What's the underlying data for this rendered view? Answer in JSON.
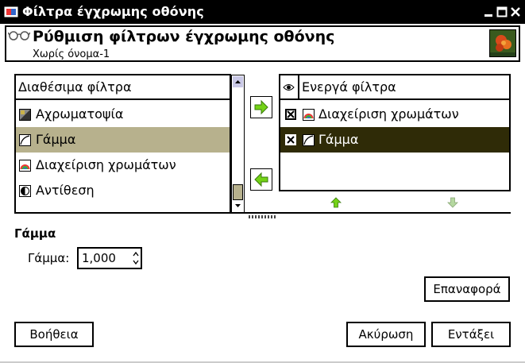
{
  "window": {
    "title": "Φίλτρα έγχρωμης οθόνης"
  },
  "header": {
    "title": "Ρύθμιση φίλτρων έγχρωμης οθόνης",
    "subtitle": "Χωρίς όνομα-1"
  },
  "available": {
    "heading": "Διαθέσιμα φίλτρα",
    "items": [
      {
        "label": "Αχρωματοψία",
        "icon": "color-deficient-icon"
      },
      {
        "label": "Γάμμα",
        "icon": "gamma-icon"
      },
      {
        "label": "Διαχείριση χρωμάτων",
        "icon": "color-management-icon"
      },
      {
        "label": "Αντίθεση",
        "icon": "contrast-icon"
      }
    ]
  },
  "active": {
    "heading": "Ενεργά φίλτρα",
    "items": [
      {
        "label": "Διαχείριση χρωμάτων",
        "icon": "color-management-icon",
        "checked": true
      },
      {
        "label": "Γάμμα",
        "icon": "gamma-icon",
        "checked": true
      }
    ]
  },
  "settings": {
    "section_title": "Γάμμα",
    "gamma_label": "Γάμμα:",
    "gamma_value": "1,000"
  },
  "buttons": {
    "reset": "Επαναφορά",
    "help": "Βοήθεια",
    "cancel": "Ακύρωση",
    "ok": "Εντάξει"
  },
  "colors": {
    "titlebar": "#000000",
    "selection_light": "#b7b18d",
    "selection_dark": "#2f2b07",
    "arrow_green": "#73d216"
  }
}
